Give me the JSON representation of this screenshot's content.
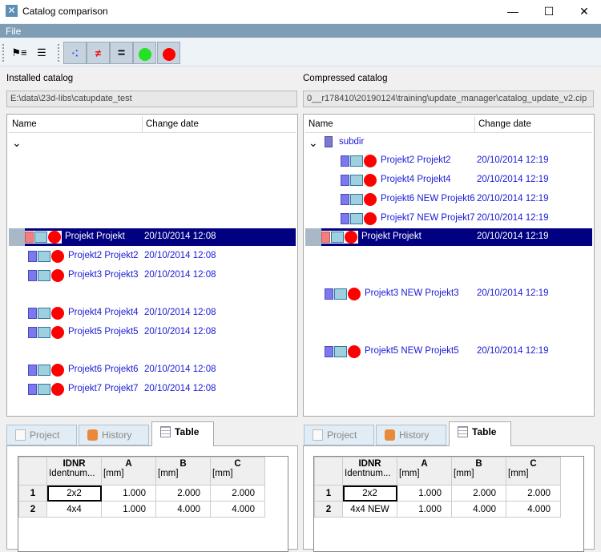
{
  "window": {
    "title": "Catalog comparison",
    "minimize": "—",
    "maximize": "☐",
    "close": "✕"
  },
  "menu": {
    "file": "File"
  },
  "toolbar": [
    {
      "name": "tree-expand-icon",
      "glyph": "⚑≡"
    },
    {
      "name": "tree-list-icon",
      "glyph": "☰"
    },
    {
      "name": "show-differences-button",
      "glyph": "⁖"
    },
    {
      "name": "not-equal-button",
      "glyph": "≠"
    },
    {
      "name": "equal-button",
      "glyph": "="
    },
    {
      "name": "green-status-button",
      "color": "#22e222"
    },
    {
      "name": "red-status-button",
      "color": "#ff0000"
    }
  ],
  "left": {
    "label": "Installed catalog",
    "path": "E:\\data\\23d-libs\\catupdate_test",
    "columns": [
      "Name",
      "Change date"
    ],
    "root_toggle": "⌄",
    "rows": [
      {
        "name": "Projekt Projekt",
        "date": "20/10/2014 12:08",
        "selected": true
      },
      {
        "name": "Projekt2 Projekt2",
        "date": "20/10/2014 12:08"
      },
      {
        "name": "Projekt3 Projekt3",
        "date": "20/10/2014 12:08"
      },
      {
        "name": "Projekt4 Projekt4",
        "date": "20/10/2014 12:08"
      },
      {
        "name": "Projekt5 Projekt5",
        "date": "20/10/2014 12:08"
      },
      {
        "name": "Projekt6 Projekt6",
        "date": "20/10/2014 12:08"
      },
      {
        "name": "Projekt7 Projekt7",
        "date": "20/10/2014 12:08"
      }
    ],
    "tabs": [
      "Project",
      "History",
      "Table"
    ],
    "table": {
      "headers": [
        {
          "top": "IDNR",
          "bottom": "Identnum..."
        },
        {
          "top": "A",
          "bottom": "[mm]"
        },
        {
          "top": "B",
          "bottom": "[mm]"
        },
        {
          "top": "C",
          "bottom": "[mm]"
        }
      ],
      "rows": [
        [
          "1",
          "2x2",
          "1.000",
          "2.000",
          "2.000"
        ],
        [
          "2",
          "4x4",
          "1.000",
          "4.000",
          "4.000"
        ]
      ]
    }
  },
  "right": {
    "label": "Compressed catalog",
    "path": "0__r178410\\20190124\\training\\update_manager\\catalog_update_v2.cip",
    "columns": [
      "Name",
      "Change date"
    ],
    "root_toggle": "⌄",
    "folder": "subdir",
    "rows": [
      {
        "name": "Projekt2 Projekt2",
        "date": "20/10/2014 12:19"
      },
      {
        "name": "Projekt4 Projekt4",
        "date": "20/10/2014 12:19"
      },
      {
        "name": "Projekt6 NEW Projekt6",
        "date": "20/10/2014 12:19"
      },
      {
        "name": "Projekt7 NEW Projekt7",
        "date": "20/10/2014 12:19"
      },
      {
        "name": "Projekt Projekt",
        "date": "20/10/2014 12:19",
        "selected": true
      },
      {
        "name": "Projekt3 NEW Projekt3",
        "date": "20/10/2014 12:19"
      },
      {
        "name": "Projekt5 NEW Projekt5",
        "date": "20/10/2014 12:19"
      }
    ],
    "tabs": [
      "Project",
      "History",
      "Table"
    ],
    "table": {
      "headers": [
        {
          "top": "IDNR",
          "bottom": "Identnum..."
        },
        {
          "top": "A",
          "bottom": "[mm]"
        },
        {
          "top": "B",
          "bottom": "[mm]"
        },
        {
          "top": "C",
          "bottom": "[mm]"
        }
      ],
      "rows": [
        [
          "1",
          "2x2",
          "1.000",
          "2.000",
          "2.000"
        ],
        [
          "2",
          "4x4 NEW",
          "1.000",
          "4.000",
          "4.000"
        ]
      ]
    }
  }
}
